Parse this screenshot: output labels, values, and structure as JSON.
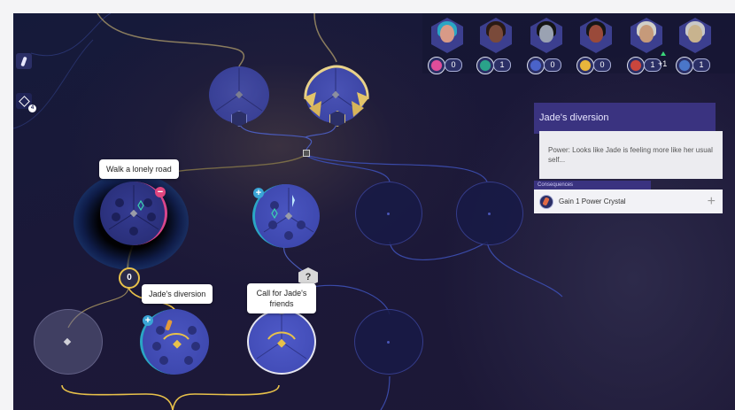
{
  "sidebar": {
    "map_marker_count": "4"
  },
  "characters": [
    {
      "name": "character-1",
      "crystal_color": "#e04d9a",
      "count": "0",
      "skin": "#d89a87",
      "hair": "#2aa6c4"
    },
    {
      "name": "character-2",
      "crystal_color": "#2aa38a",
      "count": "1",
      "skin": "#7a4a3a",
      "hair": "#2a1a14"
    },
    {
      "name": "character-3",
      "crystal_color": "#4a63c9",
      "count": "0",
      "skin": "#9aa2b2",
      "hair": "#141414"
    },
    {
      "name": "character-4",
      "crystal_color": "#e8b53b",
      "count": "0",
      "skin": "#9a4a3a",
      "hair": "#161616"
    },
    {
      "name": "character-5",
      "crystal_color": "#c9463d",
      "count": "1",
      "extra": "+1",
      "skin": "#c69a7a",
      "hair": "#d0cfc8"
    },
    {
      "name": "character-6",
      "crystal_color": "#4a76c9",
      "count": "1",
      "skin": "#c8b38e",
      "hair": "#c8c8c8"
    }
  ],
  "tooltips": {
    "walk_lonely_road": "Walk a lonely road",
    "jades_diversion": "Jade's diversion",
    "call_for_friends": "Call for Jade's friends"
  },
  "badges": {
    "zero": "0",
    "question": "?"
  },
  "panel": {
    "title": "Jade's diversion",
    "description": "Power: Looks like Jade is feeling more like her usual self...",
    "consequences_label": "Consequences",
    "consequence": "Gain 1 Power Crystal",
    "add_symbol": "+"
  },
  "colors": {
    "accent_pink": "#e0467f",
    "accent_gold": "#e8b53b",
    "panel_purple": "#3a3380",
    "node_blue": "#3f46b0"
  }
}
